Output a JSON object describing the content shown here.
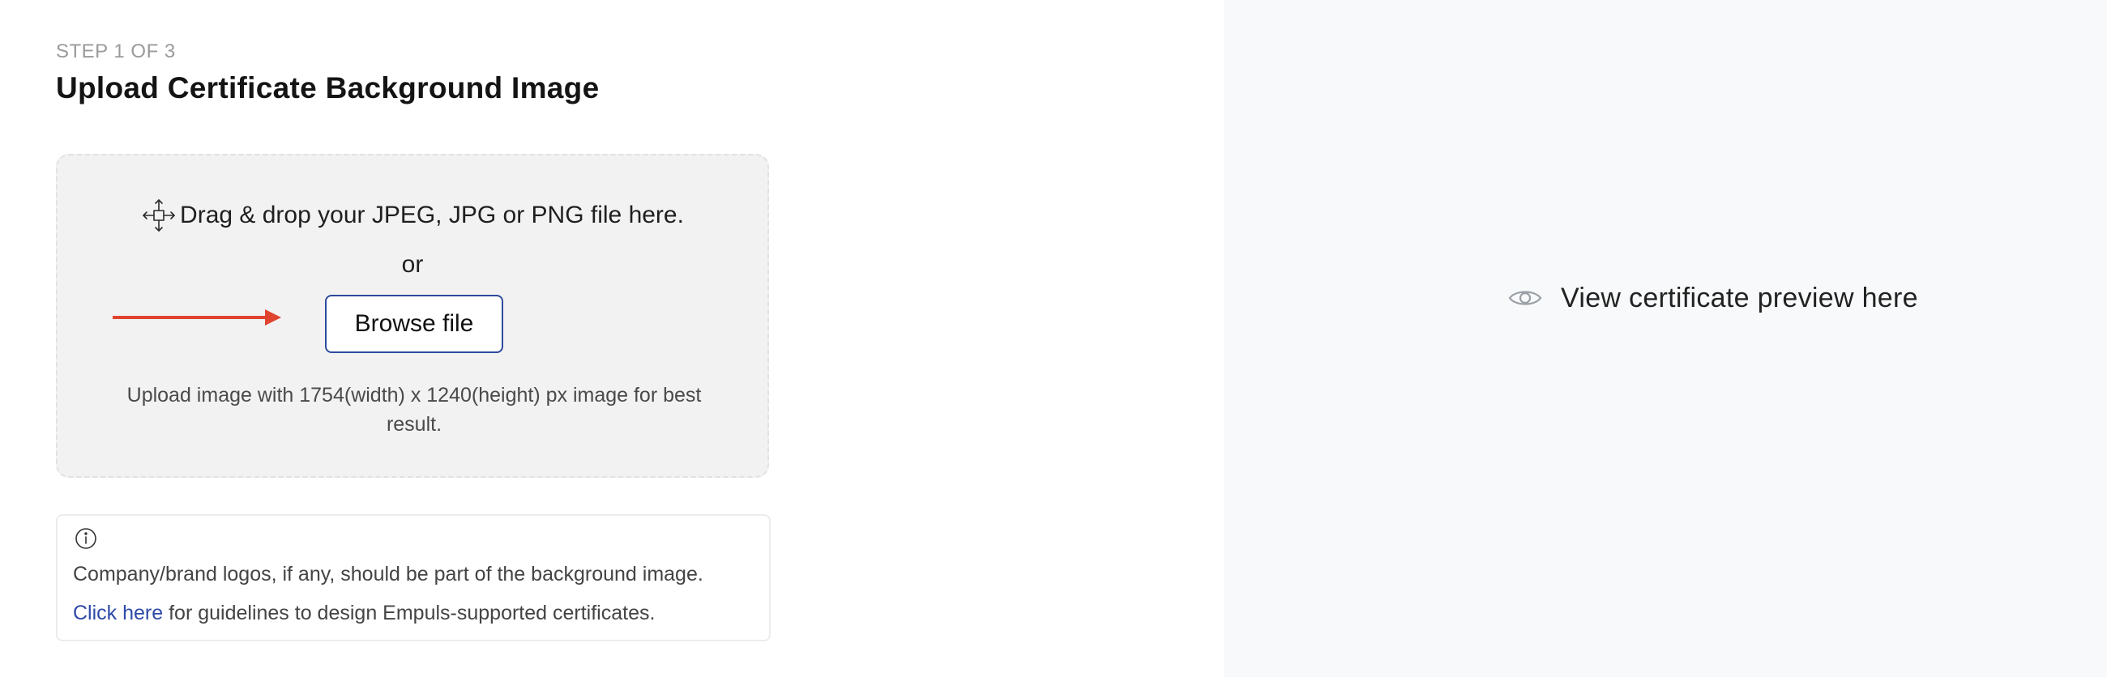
{
  "header": {
    "step_label": "STEP 1 OF 3",
    "title": "Upload Certificate Background Image"
  },
  "dropzone": {
    "icon": "move-icon",
    "instruction": "Drag & drop your JPEG, JPG or PNG file here.",
    "or_label": "or",
    "browse_label": "Browse file",
    "hint": "Upload image with 1754(width) x 1240(height) px image for best result."
  },
  "annotation": {
    "arrow_color": "#e0442f"
  },
  "info": {
    "icon": "info-icon",
    "line1": "Company/brand logos, if any, should be part of the background image.",
    "link_text": "Click here",
    "line2_rest": " for guidelines to design Empuls-supported certificates."
  },
  "preview": {
    "icon": "eye-icon",
    "text": "View certificate preview here"
  },
  "colors": {
    "accent": "#2d4a9e",
    "link": "#2f4aa8",
    "preview_bg": "#f8f9fa"
  }
}
